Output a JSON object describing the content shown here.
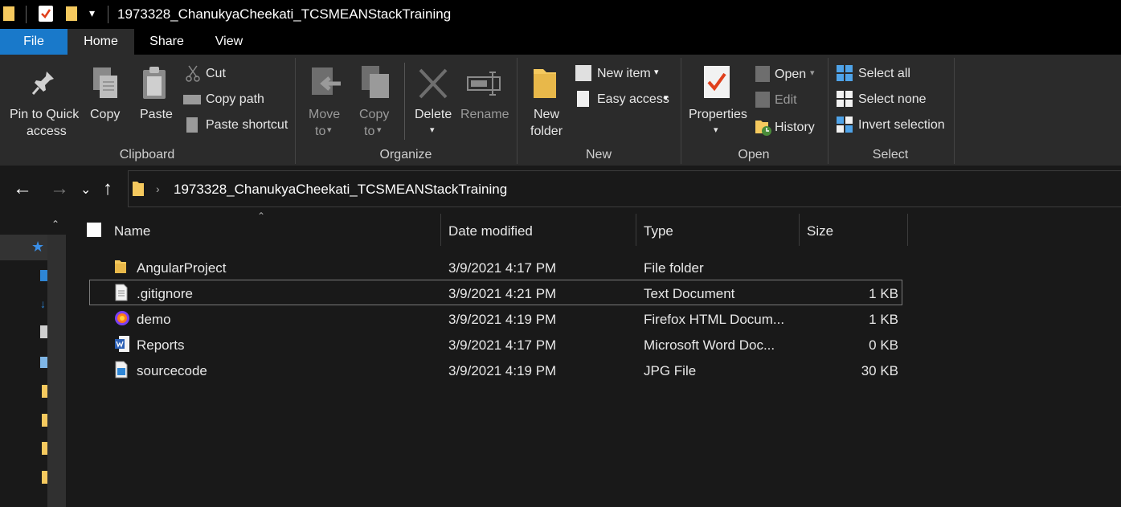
{
  "window": {
    "title": "1973328_ChanukyaCheekati_TCSMEANStackTraining"
  },
  "menu": {
    "tabs": [
      "File",
      "Home",
      "Share",
      "View"
    ]
  },
  "ribbon": {
    "clipboard": {
      "group_label": "Clipboard",
      "pin_line1": "Pin to Quick",
      "pin_line2": "access",
      "copy": "Copy",
      "paste": "Paste",
      "cut": "Cut",
      "copy_path": "Copy path",
      "paste_shortcut": "Paste shortcut"
    },
    "organize": {
      "group_label": "Organize",
      "move_line1": "Move",
      "move_line2": "to",
      "copy_line1": "Copy",
      "copy_line2": "to",
      "delete": "Delete",
      "rename": "Rename"
    },
    "new": {
      "group_label": "New",
      "folder_line1": "New",
      "folder_line2": "folder",
      "new_item": "New item",
      "easy_access": "Easy access"
    },
    "open": {
      "group_label": "Open",
      "properties": "Properties",
      "open": "Open",
      "edit": "Edit",
      "history": "History"
    },
    "select": {
      "group_label": "Select",
      "select_all": "Select all",
      "select_none": "Select none",
      "invert": "Invert selection"
    }
  },
  "address": {
    "path": "1973328_ChanukyaCheekati_TCSMEANStackTraining"
  },
  "columns": {
    "name": "Name",
    "date": "Date modified",
    "type": "Type",
    "size": "Size"
  },
  "files": [
    {
      "name": "AngularProject",
      "date": "3/9/2021 4:17 PM",
      "type": "File folder",
      "size": "",
      "icon": "folder-icon"
    },
    {
      "name": ".gitignore",
      "date": "3/9/2021 4:21 PM",
      "type": "Text Document",
      "size": "1 KB",
      "icon": "text-file-icon"
    },
    {
      "name": "demo",
      "date": "3/9/2021 4:19 PM",
      "type": "Firefox HTML Docum...",
      "size": "1 KB",
      "icon": "firefox-icon"
    },
    {
      "name": "Reports",
      "date": "3/9/2021 4:17 PM",
      "type": "Microsoft Word Doc...",
      "size": "0 KB",
      "icon": "word-icon"
    },
    {
      "name": "sourcecode",
      "date": "3/9/2021 4:19 PM",
      "type": "JPG File",
      "size": "30 KB",
      "icon": "image-file-icon"
    }
  ],
  "colors": {
    "accent": "#1979ca",
    "folder": "#f5c95e"
  }
}
